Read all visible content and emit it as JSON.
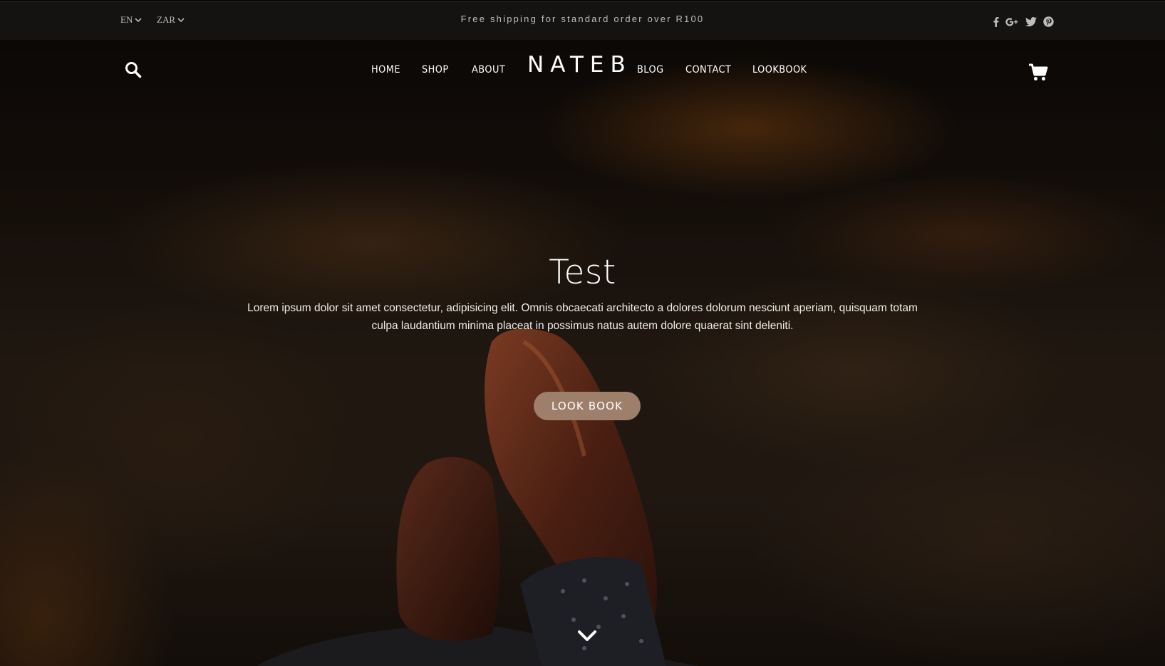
{
  "topbar": {
    "language": "EN",
    "currency": "ZAR",
    "announcement": "Free shipping for standard order over R100",
    "socials": [
      {
        "icon": "facebook-icon",
        "glyph": "f"
      },
      {
        "icon": "google-plus-icon",
        "glyph": "G+"
      },
      {
        "icon": "twitter-icon",
        "glyph": ""
      },
      {
        "icon": "pinterest-icon",
        "glyph": ""
      }
    ]
  },
  "header": {
    "logo": "NATEB",
    "nav_left": [
      "HOME",
      "SHOP",
      "ABOUT"
    ],
    "nav_right": [
      "BLOG",
      "CONTACT",
      "LOOKBOOK"
    ]
  },
  "hero": {
    "title": "Test",
    "text": "Lorem ipsum dolor sit amet consectetur, adipisicing elit. Omnis obcaecati architecto a dolores dolorum nesciunt aperiam, quisquam totam culpa laudantium minima placeat in possimus natus autem dolore quaerat sint deleniti.",
    "cta_label": "LOOK BOOK"
  },
  "colors": {
    "topbar_bg": "#141312",
    "cta_bg": "#9e7f6b",
    "text_light": "#ffffff",
    "text_muted": "#bdbdbd"
  }
}
